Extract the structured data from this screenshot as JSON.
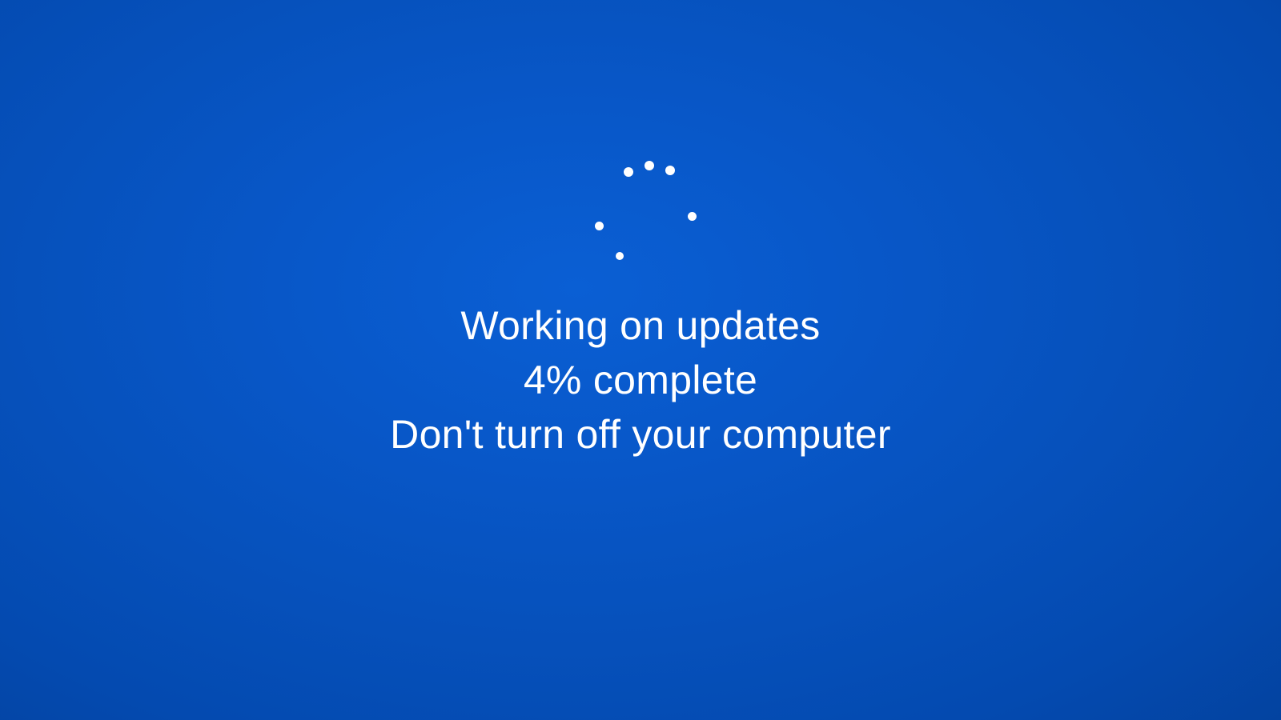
{
  "update": {
    "status_line": "Working on updates",
    "progress_line": "4% complete",
    "warning_line": "Don't turn off your computer",
    "percent": 4
  },
  "colors": {
    "background": "#0756c4",
    "text": "#ffffff"
  },
  "icons": {
    "spinner": "loading-spinner-icon"
  }
}
